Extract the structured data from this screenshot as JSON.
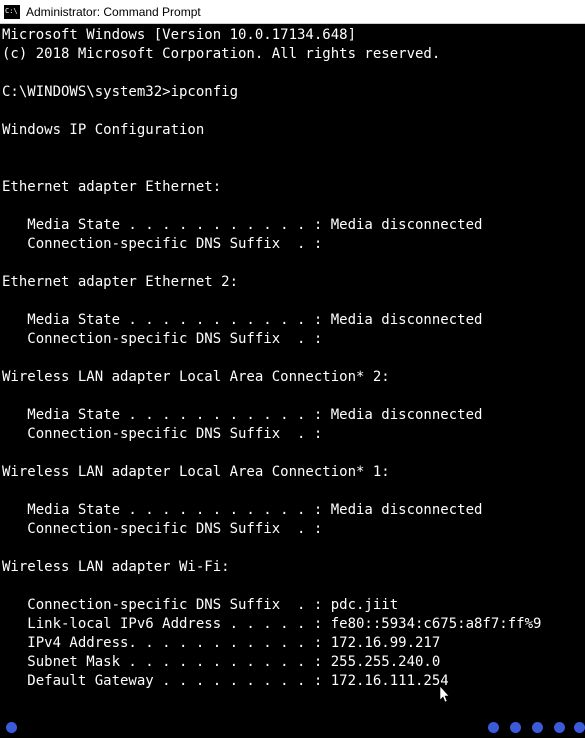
{
  "titlebar": {
    "title": "Administrator: Command Prompt"
  },
  "terminal": {
    "header_line1": "Microsoft Windows [Version 10.0.17134.648]",
    "header_line2": "(c) 2018 Microsoft Corporation. All rights reserved.",
    "prompt": "C:\\WINDOWS\\system32>",
    "command": "ipconfig",
    "section_title": "Windows IP Configuration",
    "adapters": [
      {
        "header": "Ethernet adapter Ethernet:",
        "lines": [
          "   Media State . . . . . . . . . . . : Media disconnected",
          "   Connection-specific DNS Suffix  . :"
        ]
      },
      {
        "header": "Ethernet adapter Ethernet 2:",
        "lines": [
          "   Media State . . . . . . . . . . . : Media disconnected",
          "   Connection-specific DNS Suffix  . :"
        ]
      },
      {
        "header": "Wireless LAN adapter Local Area Connection* 2:",
        "lines": [
          "   Media State . . . . . . . . . . . : Media disconnected",
          "   Connection-specific DNS Suffix  . :"
        ]
      },
      {
        "header": "Wireless LAN adapter Local Area Connection* 1:",
        "lines": [
          "   Media State . . . . . . . . . . . : Media disconnected",
          "   Connection-specific DNS Suffix  . :"
        ]
      },
      {
        "header": "Wireless LAN adapter Wi-Fi:",
        "lines": [
          "   Connection-specific DNS Suffix  . : pdc.jiit",
          "   Link-local IPv6 Address . . . . . : fe80::5934:c675:a8f7:ff%9",
          "   IPv4 Address. . . . . . . . . . . : 172.16.99.217",
          "   Subnet Mask . . . . . . . . . . . : 255.255.240.0",
          "   Default Gateway . . . . . . . . . : 172.16.111.254"
        ]
      }
    ]
  }
}
